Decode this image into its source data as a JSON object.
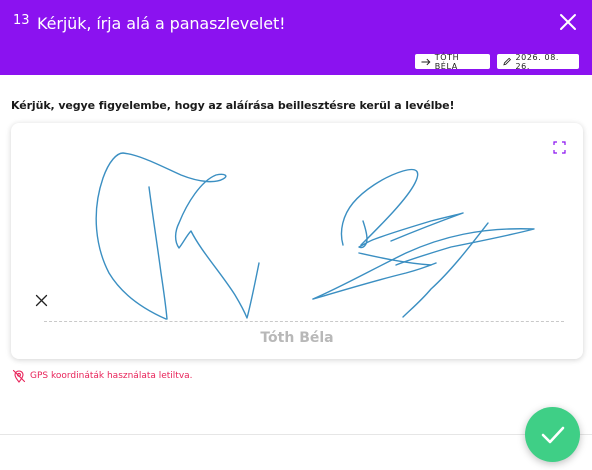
{
  "header": {
    "step": "13",
    "title": "Kérjük, írja alá a panaszlevelet!",
    "signer_chip": "TÓTH BÉLA",
    "date_chip": "2026. 08. 26.",
    "background_color": "#8b12f0"
  },
  "notice": "Kérjük, vegye figyelembe, hogy az aláírása beillesztésre kerül a levélbe!",
  "signature_pad": {
    "signer_name": "Tóth Béla",
    "stroke_color": "#3b8fc2",
    "icons": [
      "expand-icon",
      "clear-icon"
    ]
  },
  "gps_status": "GPS koordináták használata letiltva.",
  "confirm": {
    "icon": "check-icon",
    "color": "#3fcf86"
  }
}
